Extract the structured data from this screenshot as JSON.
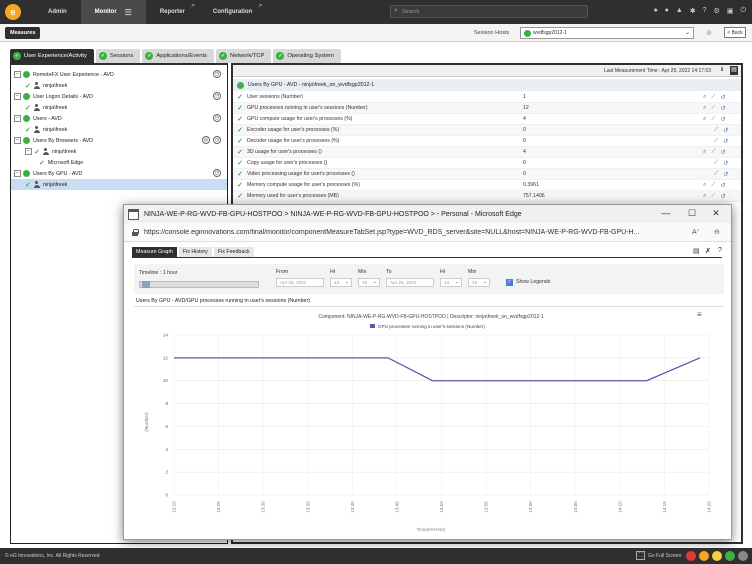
{
  "topbar": {
    "logo_letter": "e",
    "tabs": [
      {
        "label": "Admin"
      },
      {
        "label": "Monitor"
      },
      {
        "label": "Reporter"
      },
      {
        "label": "Configuration"
      }
    ],
    "search_placeholder": "Search",
    "icons": [
      "bell-icon",
      "user-icon",
      "warning-icon",
      "bug-icon",
      "help-icon",
      "settings-icon",
      "lock-icon",
      "logout-icon"
    ]
  },
  "measures": {
    "tab_label": "Measures",
    "session_hosts_label": "Session Hosts",
    "session_host_value": "wvdfsgp2012-1",
    "back_label": "< Back"
  },
  "category_tabs": [
    {
      "label": "User Experience/Activity"
    },
    {
      "label": "Sessions"
    },
    {
      "label": "Applications/Events"
    },
    {
      "label": "Network/TCP"
    },
    {
      "label": "Operating System"
    }
  ],
  "tree": [
    {
      "label": "RemoteFX User Experience - AVD"
    },
    {
      "label": "ninja\\freek"
    },
    {
      "label": "User Logon Details - AVD"
    },
    {
      "label": "ninja\\freek"
    },
    {
      "label": "Users - AVD"
    },
    {
      "label": "ninja\\freek"
    },
    {
      "label": "Users By Browsers - AVD"
    },
    {
      "label": "ninja\\freek"
    },
    {
      "label": "Microsoft Edge"
    },
    {
      "label": "Users By GPU - AVD"
    },
    {
      "label": "ninja\\freek"
    }
  ],
  "right_panel": {
    "last_measurement": "Last Measurement Time : Apr 25, 2022 14:17:53",
    "title": "Users By GPU - AVD - ninja\\freek_on_wvdfsgp2012-1",
    "rows": [
      {
        "name": "User sessions (Number)",
        "value": "1"
      },
      {
        "name": "GPU processes running in user's sessions (Number)",
        "value": "12"
      },
      {
        "name": "GPU compute usage for user's processes (%)",
        "value": "4"
      },
      {
        "name": "Encoder usage for user's processes (%)",
        "value": "0"
      },
      {
        "name": "Decoder usage for user's processes (%)",
        "value": "0"
      },
      {
        "name": "3D usage for user's processes ()",
        "value": "4"
      },
      {
        "name": "Copy usage for user's processes ()",
        "value": "0"
      },
      {
        "name": "Video processing usage for user's processes ()",
        "value": "0"
      },
      {
        "name": "Memory compute usage for user's processes (%)",
        "value": "0.3961"
      },
      {
        "name": "Memory used for user's processes (MB)",
        "value": "757.1406"
      }
    ]
  },
  "popup": {
    "title": "NINJA-WE-P-RG-WVD-FB-GPU-HOSTPOO > NINJA-WE-P-RG-WVD-FB-GPU-HOSTPOO > - Personal - Microsoft Edge",
    "url": "https://console.eginnovations.com/final/monitor/componentMeasureTabSet.jsp?type=WVD_RDS_server&site=NULL&host=NINJA-WE-P-RG-WVD-FB-GPU-H...",
    "tabs": [
      {
        "label": "Measure Graph"
      },
      {
        "label": "Fix History"
      },
      {
        "label": "Fix Feedback"
      }
    ],
    "timeline_label": "Timeline : 1 hour",
    "from_label": "From",
    "from_date": "Apr 25, 2022",
    "to_label": "To",
    "to_date": "Apr 25, 2022",
    "hr_label": "Hr",
    "min_label": "Min",
    "from_hr": "13",
    "from_min": "19",
    "to_hr": "14",
    "to_min": "19",
    "show_legends": "Show Legends",
    "graph_heading": "Users By GPU - AVD/GPU processes running in user's sessions (Number)"
  },
  "chart_data": {
    "type": "line",
    "title": "Component: NINJA-WE-P-RG-WVD-FB-GPU-HOSTPOO | Descriptor: ninja\\freek_on_wvdfsgp2012-1",
    "xlabel": "Time(HH:mm)",
    "ylabel": "(Number)",
    "x_ticks": [
      "13:20",
      "13:25",
      "13:30",
      "13:35",
      "13:40",
      "13:45",
      "13:50",
      "13:55",
      "14:00",
      "14:05",
      "14:10",
      "14:15",
      "14:20"
    ],
    "y_ticks": [
      0,
      2,
      4,
      6,
      8,
      10,
      12,
      14
    ],
    "ylim": [
      0,
      14
    ],
    "grid": true,
    "series": [
      {
        "name": "GPU processes running in user's sessions (Number)",
        "color": "#5b55a8",
        "x": [
          "13:20",
          "13:44",
          "13:49",
          "14:13",
          "14:19"
        ],
        "values": [
          12,
          12,
          10,
          10,
          12
        ]
      }
    ]
  },
  "footer": {
    "copyright": "© eG Innovations, Inc. All Rights Reserved",
    "fullscreen": "Go Full Screen"
  }
}
